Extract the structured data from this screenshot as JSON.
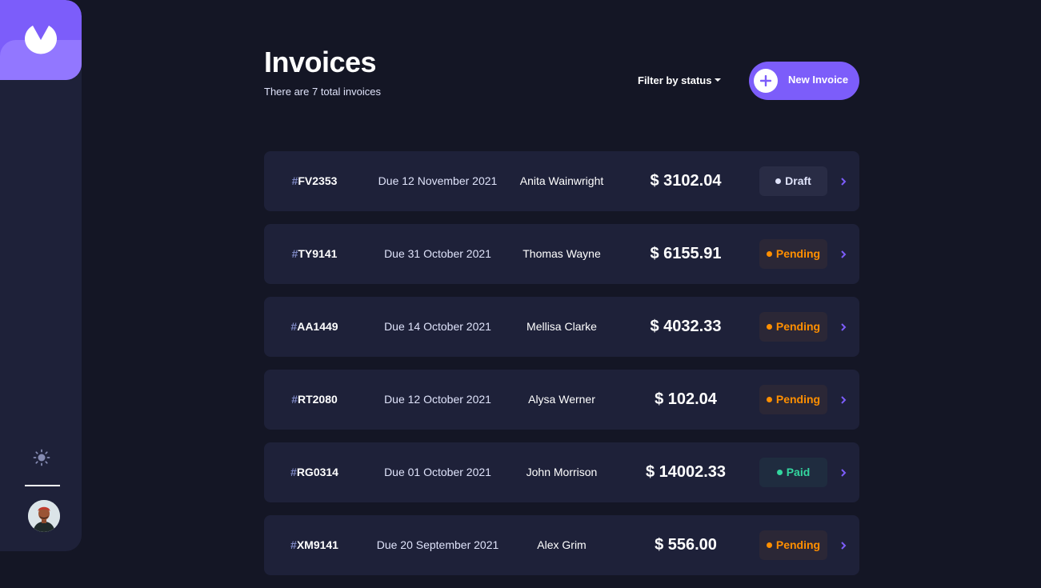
{
  "header": {
    "title": "Invoices",
    "subtitle": "There are 7 total invoices",
    "filter_label": "Filter by status",
    "new_button_label": "New Invoice"
  },
  "colors": {
    "background": "#141625",
    "card": "#1e2139",
    "accent": "#7c5dfa",
    "draft": "#dfe3fa",
    "pending": "#ff8f00",
    "paid": "#33d69f"
  },
  "invoices": [
    {
      "hash": "#",
      "id": "FV2353",
      "due": "Due 12 November 2021",
      "client": "Anita Wainwright",
      "amount": "$ 3102.04",
      "status": "Draft"
    },
    {
      "hash": "#",
      "id": "TY9141",
      "due": "Due 31 October 2021",
      "client": "Thomas Wayne",
      "amount": "$ 6155.91",
      "status": "Pending"
    },
    {
      "hash": "#",
      "id": "AA1449",
      "due": "Due 14 October 2021",
      "client": "Mellisa Clarke",
      "amount": "$ 4032.33",
      "status": "Pending"
    },
    {
      "hash": "#",
      "id": "RT2080",
      "due": "Due 12 October 2021",
      "client": "Alysa Werner",
      "amount": "$ 102.04",
      "status": "Pending"
    },
    {
      "hash": "#",
      "id": "RG0314",
      "due": "Due 01 October 2021",
      "client": "John Morrison",
      "amount": "$ 14002.33",
      "status": "Paid"
    },
    {
      "hash": "#",
      "id": "XM9141",
      "due": "Due 20 September 2021",
      "client": "Alex Grim",
      "amount": "$ 556.00",
      "status": "Pending"
    }
  ],
  "icons": {
    "logo": "app-logo-icon",
    "theme_toggle": "sun-icon",
    "new_button": "plus-icon",
    "row_arrow": "chevron-right-icon"
  }
}
